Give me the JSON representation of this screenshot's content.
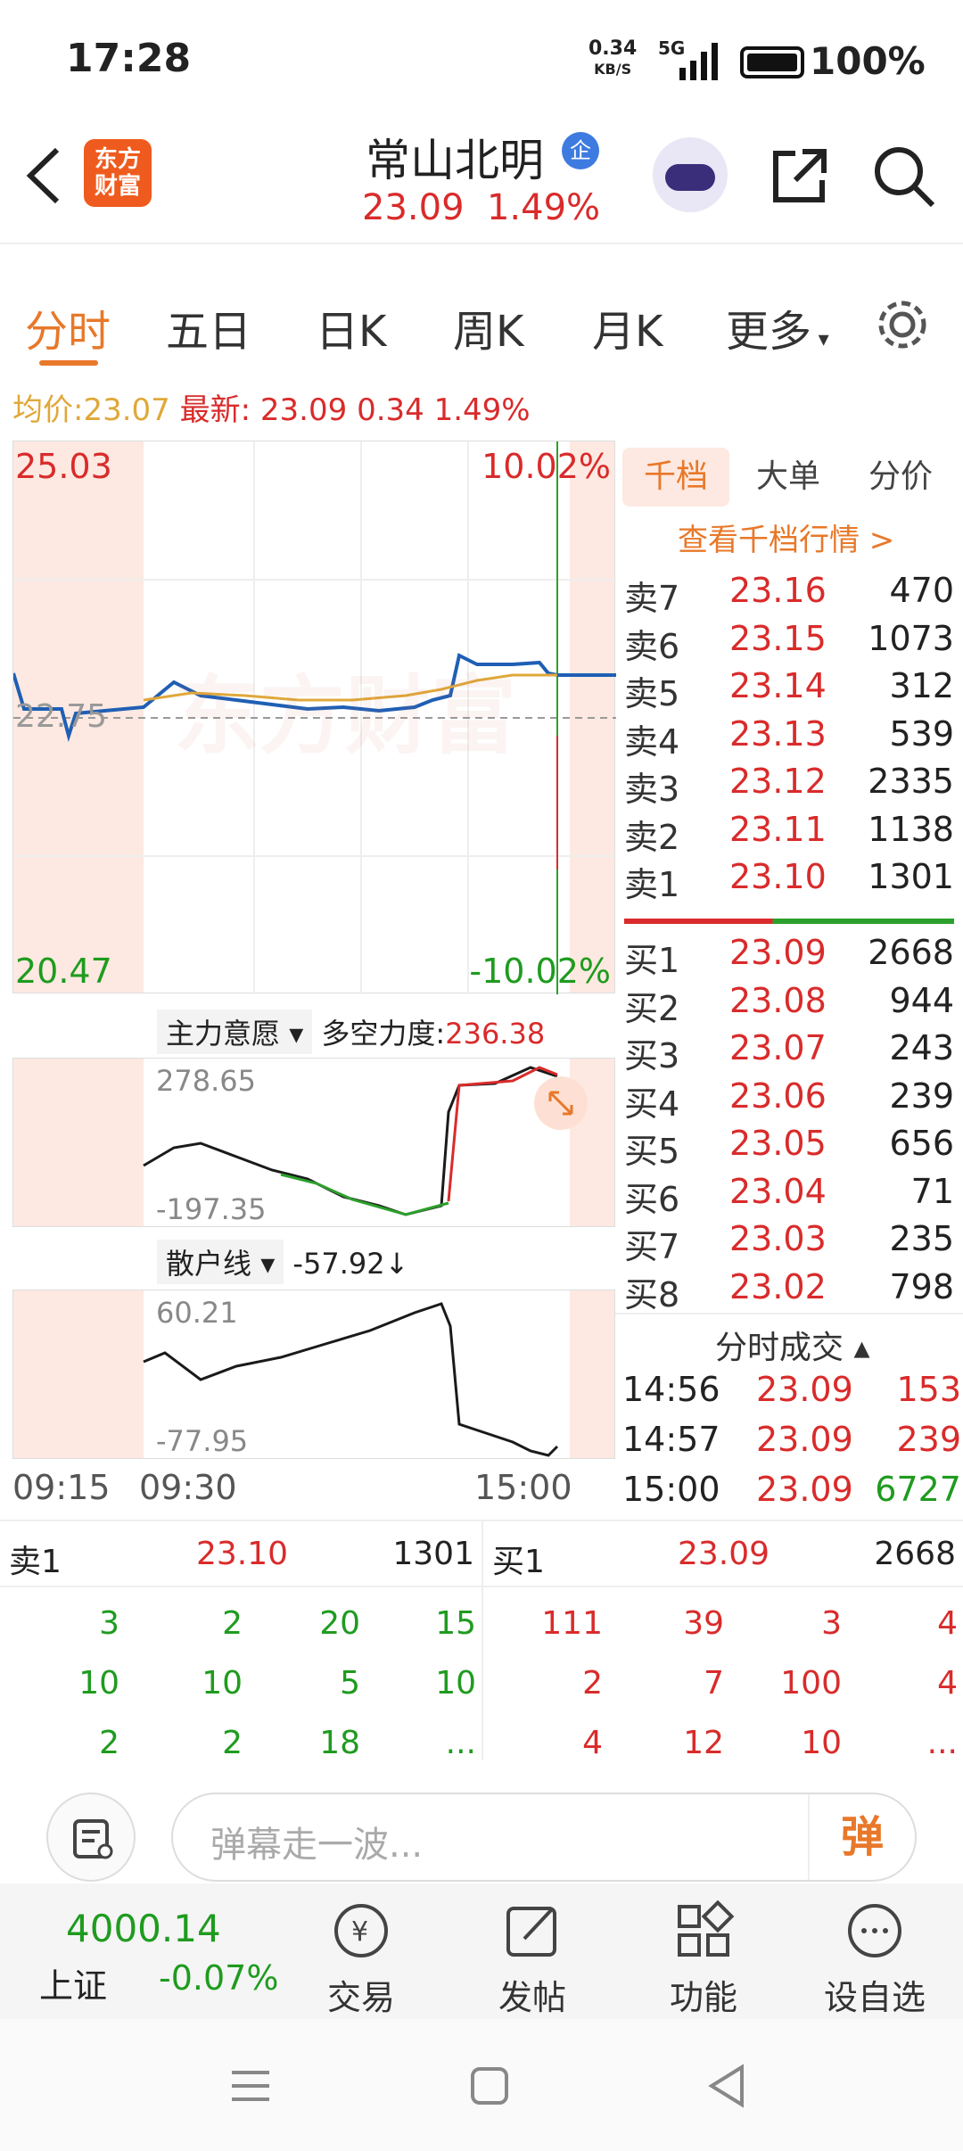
{
  "status_bar": {
    "time": "17:28",
    "net_speed": "0.34",
    "net_unit": "KB/S",
    "signal": "5G",
    "battery": "100%"
  },
  "header": {
    "logo_line1": "东方",
    "logo_line2": "财富",
    "stock_name": "常山北明",
    "badge": "企",
    "price": "23.09",
    "change_pct": "1.49%"
  },
  "tabs": [
    "分时",
    "五日",
    "日K",
    "周K",
    "月K",
    "更多"
  ],
  "avg_line": {
    "avg_label": "均价:",
    "avg_value": "23.07",
    "latest_label": "最新:",
    "latest_value": "23.09",
    "change": "0.34",
    "pct": "1.49%"
  },
  "main_chart": {
    "top_left": "25.03",
    "top_right": "10.02%",
    "mid": "22.75",
    "bottom_left": "20.47",
    "bottom_right": "-10.02%",
    "watermark": "东方财富"
  },
  "indicator1": {
    "name": "主力意愿",
    "label": "多空力度:",
    "value": "236.38",
    "max": "278.65",
    "min": "-197.35"
  },
  "indicator2": {
    "name": "散户线",
    "value": "-57.92↓",
    "max": "60.21",
    "min": "-77.95"
  },
  "time_axis": [
    "09:15",
    "09:30",
    "15:00"
  ],
  "right_panel": {
    "tabs": [
      "千档",
      "大单",
      "分价"
    ],
    "link": "查看千档行情 >",
    "sells": [
      [
        "卖7",
        "23.16",
        "470"
      ],
      [
        "卖6",
        "23.15",
        "1073"
      ],
      [
        "卖5",
        "23.14",
        "312"
      ],
      [
        "卖4",
        "23.13",
        "539"
      ],
      [
        "卖3",
        "23.12",
        "2335"
      ],
      [
        "卖2",
        "23.11",
        "1138"
      ],
      [
        "卖1",
        "23.10",
        "1301"
      ]
    ],
    "buys": [
      [
        "买1",
        "23.09",
        "2668"
      ],
      [
        "买2",
        "23.08",
        "944"
      ],
      [
        "买3",
        "23.07",
        "243"
      ],
      [
        "买4",
        "23.06",
        "239"
      ],
      [
        "买5",
        "23.05",
        "656"
      ],
      [
        "买6",
        "23.04",
        "71"
      ],
      [
        "买7",
        "23.03",
        "235"
      ],
      [
        "买8",
        "23.02",
        "798"
      ]
    ],
    "trades_title": "分时成交",
    "trades": [
      [
        "14:56",
        "23.09",
        "153"
      ],
      [
        "14:57",
        "23.09",
        "239"
      ],
      [
        "15:00",
        "23.09",
        "6727"
      ]
    ]
  },
  "summary": {
    "sell_label": "卖1",
    "sell_price": "23.10",
    "sell_vol": "1301",
    "buy_label": "买1",
    "buy_price": "23.09",
    "buy_vol": "2668",
    "sell_grid": [
      [
        "3",
        "2",
        "20",
        "15"
      ],
      [
        "10",
        "10",
        "5",
        "10"
      ],
      [
        "2",
        "2",
        "18",
        "..."
      ]
    ],
    "buy_grid": [
      [
        "111",
        "39",
        "3",
        "4"
      ],
      [
        "2",
        "7",
        "100",
        "4"
      ],
      [
        "4",
        "12",
        "10",
        "..."
      ]
    ]
  },
  "input": {
    "placeholder": "弹幕走一波...",
    "send": "弹"
  },
  "bottom_nav": {
    "index_value": "4000.14",
    "index_name": "上证",
    "index_pct": "-0.07%",
    "items": [
      "交易",
      "发帖",
      "功能",
      "设自选"
    ]
  }
}
